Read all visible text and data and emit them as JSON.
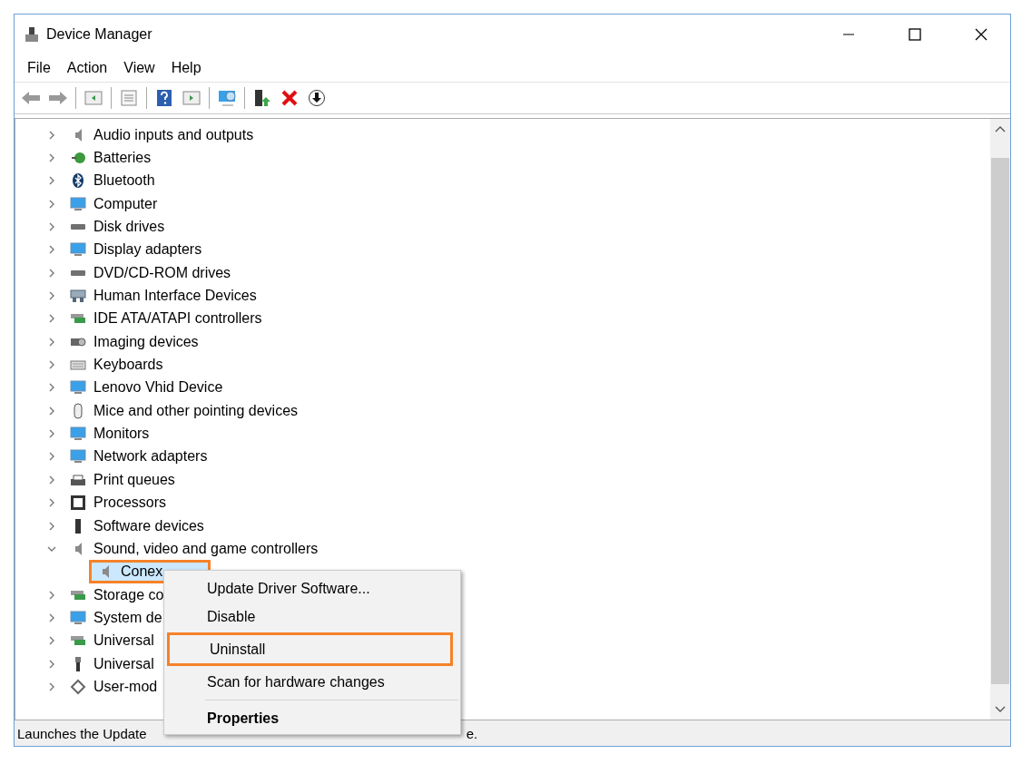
{
  "window": {
    "title": "Device Manager"
  },
  "menu_bar": [
    "File",
    "Action",
    "View",
    "Help"
  ],
  "tree": [
    {
      "label": "Audio inputs and outputs",
      "expanded": false
    },
    {
      "label": "Batteries",
      "expanded": false
    },
    {
      "label": "Bluetooth",
      "expanded": false
    },
    {
      "label": "Computer",
      "expanded": false
    },
    {
      "label": "Disk drives",
      "expanded": false
    },
    {
      "label": "Display adapters",
      "expanded": false
    },
    {
      "label": "DVD/CD-ROM drives",
      "expanded": false
    },
    {
      "label": "Human Interface Devices",
      "expanded": false
    },
    {
      "label": "IDE ATA/ATAPI controllers",
      "expanded": false
    },
    {
      "label": "Imaging devices",
      "expanded": false
    },
    {
      "label": "Keyboards",
      "expanded": false
    },
    {
      "label": "Lenovo Vhid Device",
      "expanded": false
    },
    {
      "label": "Mice and other pointing devices",
      "expanded": false
    },
    {
      "label": "Monitors",
      "expanded": false
    },
    {
      "label": "Network adapters",
      "expanded": false
    },
    {
      "label": "Print queues",
      "expanded": false
    },
    {
      "label": "Processors",
      "expanded": false
    },
    {
      "label": "Software devices",
      "expanded": false
    },
    {
      "label": "Sound, video and game controllers",
      "expanded": true,
      "children": [
        {
          "label": "Conex",
          "selected": true,
          "highlighted": true
        }
      ]
    },
    {
      "label": "Storage co",
      "expanded": false
    },
    {
      "label": "System de",
      "expanded": false
    },
    {
      "label": "Universal",
      "expanded": false
    },
    {
      "label": "Universal",
      "expanded": false
    },
    {
      "label": "User-mod",
      "expanded": false
    }
  ],
  "context_menu": [
    {
      "label": "Update Driver Software...",
      "bold": false,
      "highlighted": false,
      "separator_before": false
    },
    {
      "label": "Disable",
      "bold": false,
      "highlighted": false,
      "separator_before": false
    },
    {
      "label": "Uninstall",
      "bold": false,
      "highlighted": true,
      "separator_before": false
    },
    {
      "label": "Scan for hardware changes",
      "bold": false,
      "highlighted": false,
      "separator_before": false
    },
    {
      "label": "Properties",
      "bold": true,
      "highlighted": false,
      "separator_before": true
    }
  ],
  "status_bar": {
    "text": "Launches the Update",
    "text_end": "e."
  }
}
